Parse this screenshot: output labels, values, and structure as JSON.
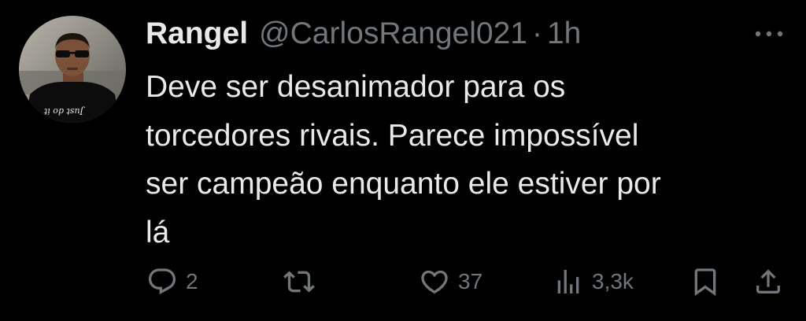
{
  "tweet": {
    "display_name": "Rangel",
    "handle": "@CarlosRangel021",
    "separator": "·",
    "time": "1h",
    "text_lines": [
      "Deve ser desanimador para os",
      "torcedores rivais. Parece impossível",
      "ser campeão enquanto ele estiver por",
      "lá"
    ],
    "avatar_shirt_text": "Just do it",
    "more_icon": "more-horizontal-icon"
  },
  "actions": {
    "reply": {
      "icon": "reply-icon",
      "count": "2"
    },
    "retweet": {
      "icon": "retweet-icon",
      "count": ""
    },
    "like": {
      "icon": "heart-icon",
      "count": "37"
    },
    "views": {
      "icon": "views-icon",
      "count": "3,3k"
    },
    "bookmark": {
      "icon": "bookmark-icon"
    },
    "share": {
      "icon": "share-icon"
    }
  },
  "colors": {
    "background": "#000000",
    "text_primary": "#e7e9ea",
    "text_secondary": "#71767b"
  }
}
